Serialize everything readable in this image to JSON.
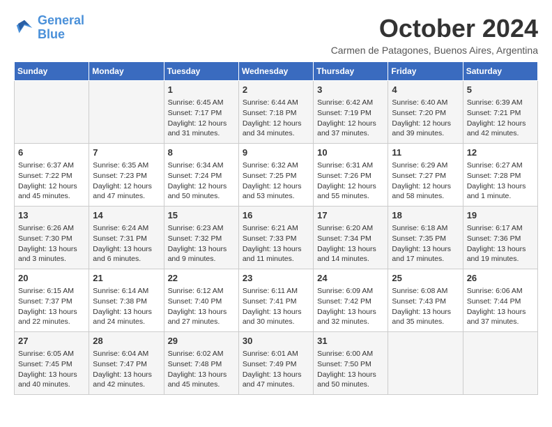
{
  "logo": {
    "line1": "General",
    "line2": "Blue"
  },
  "title": "October 2024",
  "location": "Carmen de Patagones, Buenos Aires, Argentina",
  "days_header": [
    "Sunday",
    "Monday",
    "Tuesday",
    "Wednesday",
    "Thursday",
    "Friday",
    "Saturday"
  ],
  "weeks": [
    [
      {
        "day": "",
        "content": ""
      },
      {
        "day": "",
        "content": ""
      },
      {
        "day": "1",
        "content": "Sunrise: 6:45 AM\nSunset: 7:17 PM\nDaylight: 12 hours and 31 minutes."
      },
      {
        "day": "2",
        "content": "Sunrise: 6:44 AM\nSunset: 7:18 PM\nDaylight: 12 hours and 34 minutes."
      },
      {
        "day": "3",
        "content": "Sunrise: 6:42 AM\nSunset: 7:19 PM\nDaylight: 12 hours and 37 minutes."
      },
      {
        "day": "4",
        "content": "Sunrise: 6:40 AM\nSunset: 7:20 PM\nDaylight: 12 hours and 39 minutes."
      },
      {
        "day": "5",
        "content": "Sunrise: 6:39 AM\nSunset: 7:21 PM\nDaylight: 12 hours and 42 minutes."
      }
    ],
    [
      {
        "day": "6",
        "content": "Sunrise: 6:37 AM\nSunset: 7:22 PM\nDaylight: 12 hours and 45 minutes."
      },
      {
        "day": "7",
        "content": "Sunrise: 6:35 AM\nSunset: 7:23 PM\nDaylight: 12 hours and 47 minutes."
      },
      {
        "day": "8",
        "content": "Sunrise: 6:34 AM\nSunset: 7:24 PM\nDaylight: 12 hours and 50 minutes."
      },
      {
        "day": "9",
        "content": "Sunrise: 6:32 AM\nSunset: 7:25 PM\nDaylight: 12 hours and 53 minutes."
      },
      {
        "day": "10",
        "content": "Sunrise: 6:31 AM\nSunset: 7:26 PM\nDaylight: 12 hours and 55 minutes."
      },
      {
        "day": "11",
        "content": "Sunrise: 6:29 AM\nSunset: 7:27 PM\nDaylight: 12 hours and 58 minutes."
      },
      {
        "day": "12",
        "content": "Sunrise: 6:27 AM\nSunset: 7:28 PM\nDaylight: 13 hours and 1 minute."
      }
    ],
    [
      {
        "day": "13",
        "content": "Sunrise: 6:26 AM\nSunset: 7:30 PM\nDaylight: 13 hours and 3 minutes."
      },
      {
        "day": "14",
        "content": "Sunrise: 6:24 AM\nSunset: 7:31 PM\nDaylight: 13 hours and 6 minutes."
      },
      {
        "day": "15",
        "content": "Sunrise: 6:23 AM\nSunset: 7:32 PM\nDaylight: 13 hours and 9 minutes."
      },
      {
        "day": "16",
        "content": "Sunrise: 6:21 AM\nSunset: 7:33 PM\nDaylight: 13 hours and 11 minutes."
      },
      {
        "day": "17",
        "content": "Sunrise: 6:20 AM\nSunset: 7:34 PM\nDaylight: 13 hours and 14 minutes."
      },
      {
        "day": "18",
        "content": "Sunrise: 6:18 AM\nSunset: 7:35 PM\nDaylight: 13 hours and 17 minutes."
      },
      {
        "day": "19",
        "content": "Sunrise: 6:17 AM\nSunset: 7:36 PM\nDaylight: 13 hours and 19 minutes."
      }
    ],
    [
      {
        "day": "20",
        "content": "Sunrise: 6:15 AM\nSunset: 7:37 PM\nDaylight: 13 hours and 22 minutes."
      },
      {
        "day": "21",
        "content": "Sunrise: 6:14 AM\nSunset: 7:38 PM\nDaylight: 13 hours and 24 minutes."
      },
      {
        "day": "22",
        "content": "Sunrise: 6:12 AM\nSunset: 7:40 PM\nDaylight: 13 hours and 27 minutes."
      },
      {
        "day": "23",
        "content": "Sunrise: 6:11 AM\nSunset: 7:41 PM\nDaylight: 13 hours and 30 minutes."
      },
      {
        "day": "24",
        "content": "Sunrise: 6:09 AM\nSunset: 7:42 PM\nDaylight: 13 hours and 32 minutes."
      },
      {
        "day": "25",
        "content": "Sunrise: 6:08 AM\nSunset: 7:43 PM\nDaylight: 13 hours and 35 minutes."
      },
      {
        "day": "26",
        "content": "Sunrise: 6:06 AM\nSunset: 7:44 PM\nDaylight: 13 hours and 37 minutes."
      }
    ],
    [
      {
        "day": "27",
        "content": "Sunrise: 6:05 AM\nSunset: 7:45 PM\nDaylight: 13 hours and 40 minutes."
      },
      {
        "day": "28",
        "content": "Sunrise: 6:04 AM\nSunset: 7:47 PM\nDaylight: 13 hours and 42 minutes."
      },
      {
        "day": "29",
        "content": "Sunrise: 6:02 AM\nSunset: 7:48 PM\nDaylight: 13 hours and 45 minutes."
      },
      {
        "day": "30",
        "content": "Sunrise: 6:01 AM\nSunset: 7:49 PM\nDaylight: 13 hours and 47 minutes."
      },
      {
        "day": "31",
        "content": "Sunrise: 6:00 AM\nSunset: 7:50 PM\nDaylight: 13 hours and 50 minutes."
      },
      {
        "day": "",
        "content": ""
      },
      {
        "day": "",
        "content": ""
      }
    ]
  ]
}
